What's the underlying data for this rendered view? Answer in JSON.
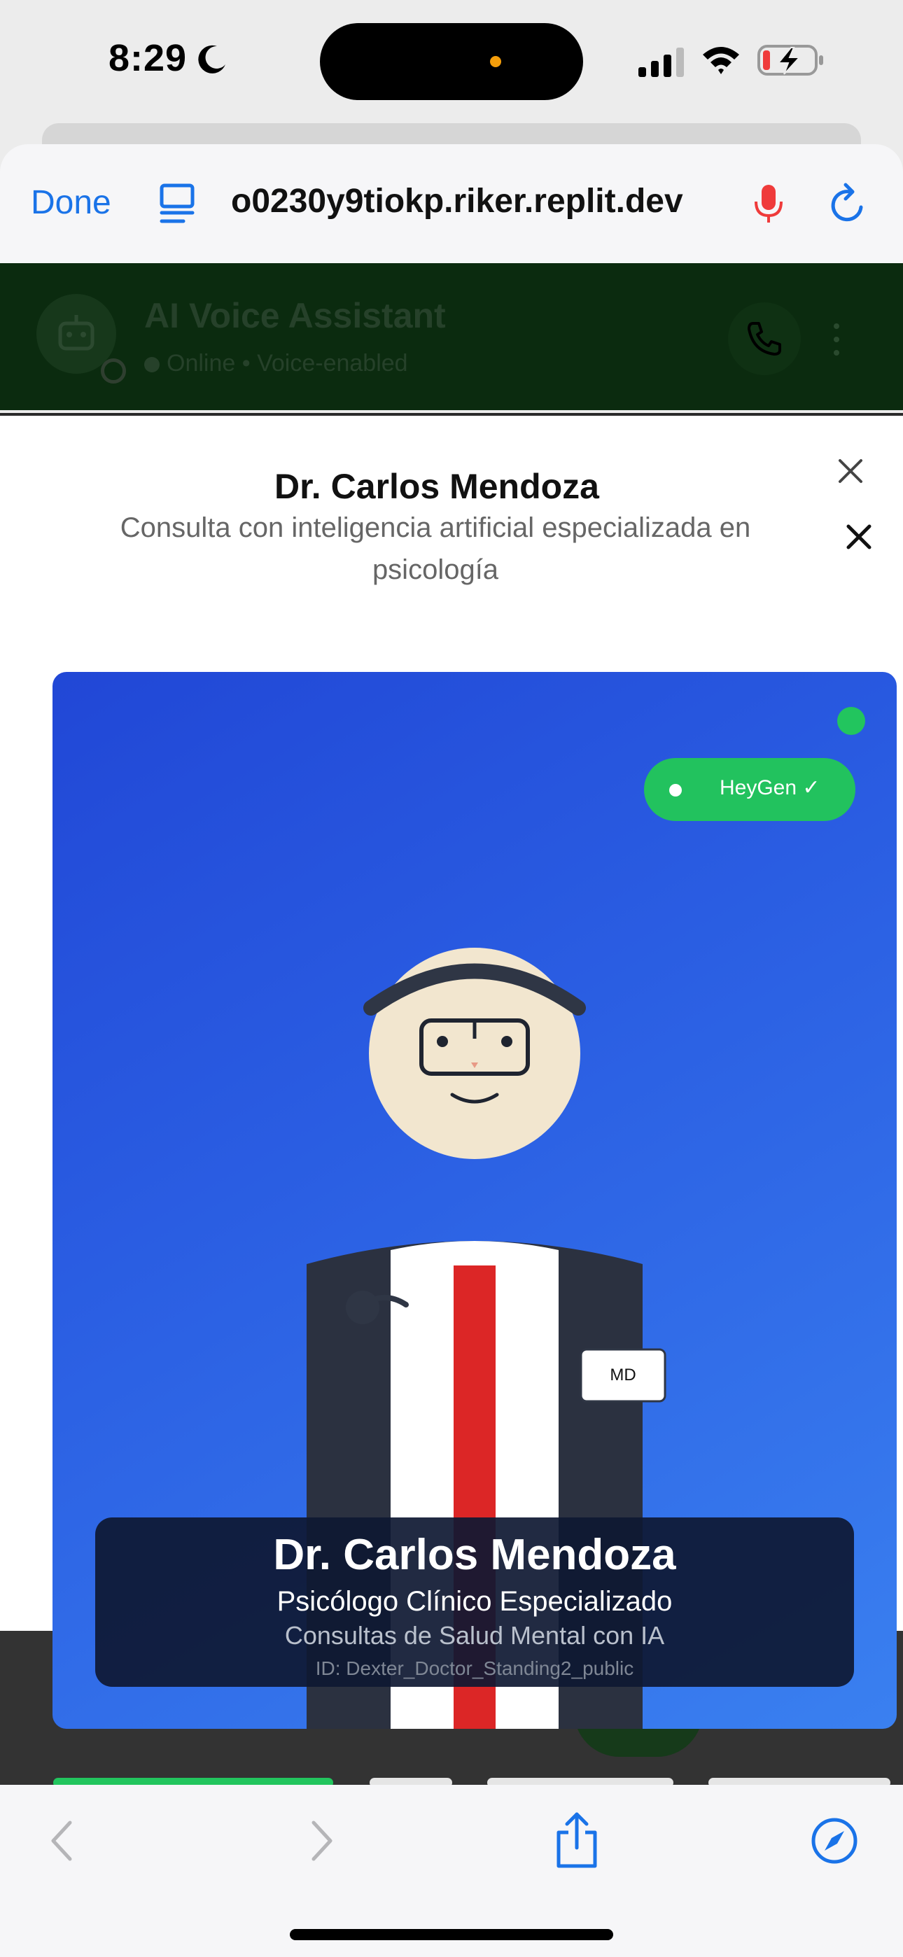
{
  "status_bar": {
    "time": "8:29"
  },
  "browser": {
    "done_label": "Done",
    "url": "o0230y9tiokp.riker.replit.dev"
  },
  "app_header": {
    "title": "AI Voice Assistant",
    "status": "Online • Voice-enabled"
  },
  "modal": {
    "title": "Dr. Carlos Mendoza",
    "subtitle": "Consulta con inteligencia artificial especializada en psicología"
  },
  "video": {
    "badge_label": "HeyGen ✓",
    "md_badge": "MD",
    "caption": {
      "name": "Dr. Carlos Mendoza",
      "role": "Psicólogo Clínico Especializado",
      "subtitle": "Consultas de Salud Mental con IA",
      "id_line": "ID: Dexter_Doctor_Standing2_public"
    }
  },
  "colors": {
    "accent_blue": "#1a73e8",
    "live_green": "#22c55e",
    "card_blue_start": "#2147d6",
    "card_blue_end": "#3a80f0",
    "tie_red": "#dc2626",
    "mic_red": "#ef3b3b"
  },
  "icons": {
    "reader": "reader-icon",
    "mic": "microphone-icon",
    "reload": "reload-icon",
    "back": "chevron-left-icon",
    "forward": "chevron-right-icon",
    "share": "share-icon",
    "compass": "compass-icon",
    "close": "close-icon",
    "call": "phone-icon",
    "more": "more-vertical-icon"
  }
}
